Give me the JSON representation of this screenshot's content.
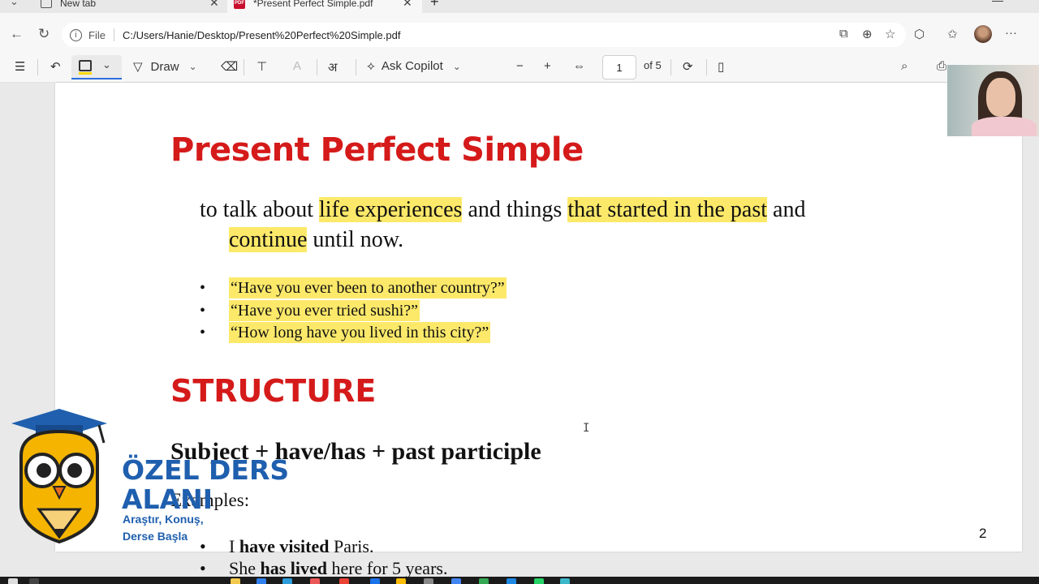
{
  "browser": {
    "tabs": [
      {
        "title": "New tab",
        "active": false
      },
      {
        "title": "*Present Perfect Simple.pdf",
        "active": true
      }
    ],
    "address": {
      "scheme_label": "File",
      "url": "C:/Users/Hanie/Desktop/Present%20Perfect%20Simple.pdf"
    }
  },
  "pdf_toolbar": {
    "draw_label": "Draw",
    "copilot_label": "Ask Copilot",
    "page_current": "1",
    "page_total": "of 5"
  },
  "document": {
    "title": "Present Perfect Simple",
    "intro": {
      "p1": "to talk about ",
      "p2": "life experiences",
      "p3": " and things ",
      "p4": "that started in the past",
      "p5": " and",
      "p6": "continue",
      "p7": " until now."
    },
    "questions": [
      "“Have you ever been to another country?”",
      "“Have you ever tried sushi?”",
      "“How long have you lived in this city?”"
    ],
    "structure_heading": "STRUCTURE",
    "formula": "Subject + have/has + past participle",
    "examples_label": "Examples:",
    "examples": [
      {
        "a": "I ",
        "b": "have visited",
        "c": " Paris."
      },
      {
        "a": "She ",
        "b": "has lived",
        "c": " here for 5 years."
      }
    ],
    "page_number": "2"
  },
  "logo": {
    "line1": "ÖZEL DERS",
    "line2": "ALANI",
    "line3": "Araştır, Konuş,",
    "line4": "Derse Başla"
  },
  "colors": {
    "heading_red": "#d51a1a",
    "highlight_yellow": "#fce96a",
    "logo_blue": "#1f5fae"
  }
}
